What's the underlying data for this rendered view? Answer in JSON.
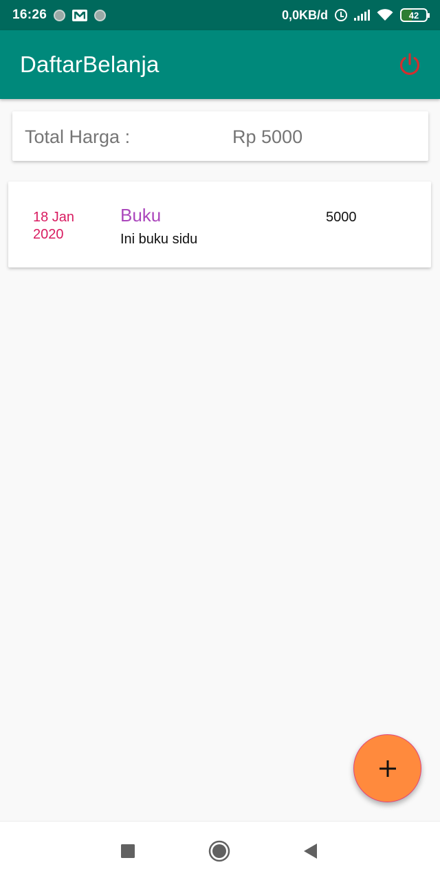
{
  "status_bar": {
    "time": "16:26",
    "net_speed": "0,0KB/d",
    "battery": "42",
    "icons": [
      "notification-dot-icon",
      "gmail-icon",
      "notification-dot-icon",
      "alarm-icon",
      "signal-icon",
      "wifi-icon",
      "battery-icon"
    ]
  },
  "app_bar": {
    "title": "DaftarBelanja",
    "logout_icon": "power-icon",
    "logout_icon_color": "#d32f2f",
    "background": "#00897b"
  },
  "total": {
    "label": "Total Harga :",
    "value": "Rp 5000"
  },
  "items": [
    {
      "date": "18 Jan 2020",
      "name": "Buku",
      "description": "Ini buku sidu",
      "price": "5000"
    }
  ],
  "fab": {
    "icon": "plus-icon",
    "color": "#ff8a3d"
  },
  "nav_bar": {
    "icons": [
      "recents-square-icon",
      "home-circle-icon",
      "back-triangle-icon"
    ]
  }
}
